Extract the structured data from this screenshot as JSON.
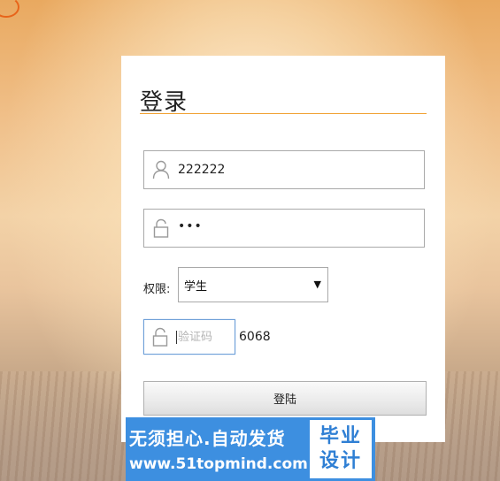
{
  "login": {
    "title": "登录",
    "username_value": "222222",
    "password_masked": "•••",
    "role": {
      "label": "权限:",
      "selected": "学生"
    },
    "captcha": {
      "placeholder": "验证码",
      "code": "6068"
    },
    "submit_label": "登陆"
  },
  "watermark": {
    "line1": "无须担心.自动发货",
    "line2": "www.51topmind.com",
    "badge_line1": "毕业",
    "badge_line2": "设计"
  },
  "colors": {
    "title_underline": "#f0a030",
    "watermark_bg": "#3d8fe0",
    "watermark_badge_text": "#2f7fd4"
  },
  "icons": [
    "user-icon",
    "lock-icon",
    "lock-icon",
    "dropdown-arrow-icon"
  ]
}
